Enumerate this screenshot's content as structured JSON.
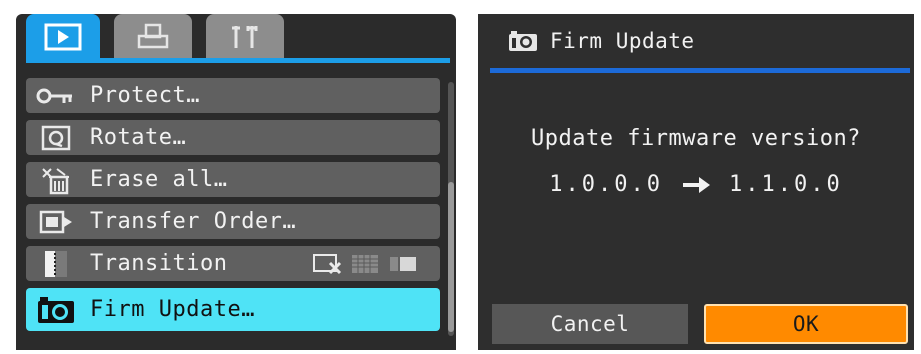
{
  "menu": {
    "tabs": [
      {
        "icon": "play-icon",
        "active": true
      },
      {
        "icon": "print-icon",
        "active": false
      },
      {
        "icon": "setup-icon",
        "active": false
      }
    ],
    "items": [
      {
        "label": "Protect…",
        "icon": "key-icon"
      },
      {
        "label": "Rotate…",
        "icon": "rotate-icon"
      },
      {
        "label": "Erase all…",
        "icon": "erase-all-icon"
      },
      {
        "label": "Transfer Order…",
        "icon": "transfer-icon"
      },
      {
        "label": "Transition",
        "icon": "transition-icon"
      },
      {
        "label": "Firm Update…",
        "icon": "camera-icon",
        "selected": true
      }
    ]
  },
  "dialog": {
    "title": "Firm Update",
    "question": "Update firmware version?",
    "current_version": "1.0.0.0",
    "new_version": "1.1.0.0",
    "cancel_label": "Cancel",
    "ok_label": "OK"
  },
  "colors": {
    "active_tab": "#1c9ee8",
    "selected_item": "#4fe3f6",
    "ok_button": "#ff8a00",
    "dialog_rule": "#1c6ad8"
  }
}
